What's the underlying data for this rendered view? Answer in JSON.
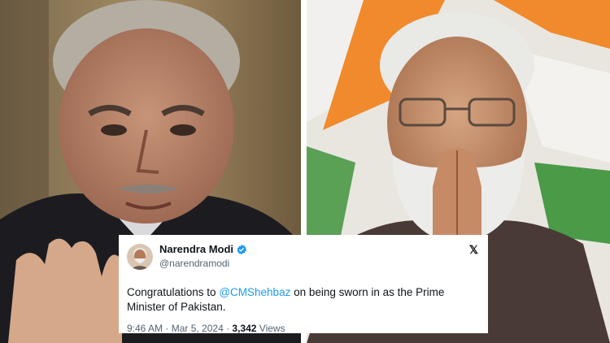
{
  "tweet": {
    "display_name": "Narendra Modi",
    "handle": "@narendramodi",
    "text_before": "Congratulations to ",
    "mention": "@CMShehbaz",
    "text_after": " on being sworn in as the Prime Minister of Pakistan.",
    "time": "9:46 AM",
    "separator": " · ",
    "date": "Mar 5, 2024",
    "views_count": "3,342",
    "views_label": " Views"
  },
  "icons": {
    "verified": "verified-badge-icon",
    "platform": "x-logo-icon",
    "avatar": "profile-avatar"
  },
  "colors": {
    "mention": "#1d9bf0",
    "verified": "#1d9bf0",
    "text": "#0f1419",
    "muted": "#536471"
  }
}
